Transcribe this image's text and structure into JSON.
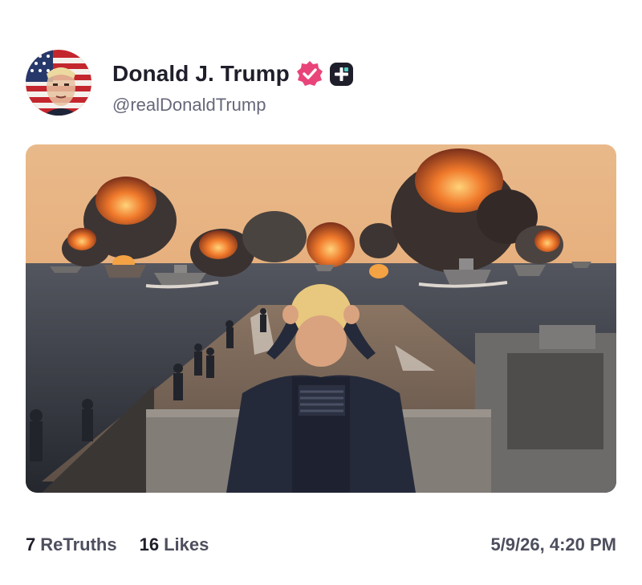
{
  "post": {
    "author": {
      "display_name": "Donald J. Trump",
      "handle": "@realDonaldTrump",
      "verified_icon": "verified-badge-icon",
      "plus_icon": "plus-badge-icon"
    },
    "media": {
      "image": "ai-generated-image-battleship-deck-explosions",
      "description_icon": "image-icon"
    },
    "stats": {
      "retruths_count": "7",
      "retruths_label": "ReTruths",
      "likes_count": "16",
      "likes_label": "Likes"
    },
    "timestamp": "5/9/26, 4:20 PM"
  },
  "colors": {
    "verified": "#e9447a",
    "plus_badge": "#1e1f2a",
    "text_primary": "#1e1f2a",
    "text_secondary": "#66687a"
  }
}
